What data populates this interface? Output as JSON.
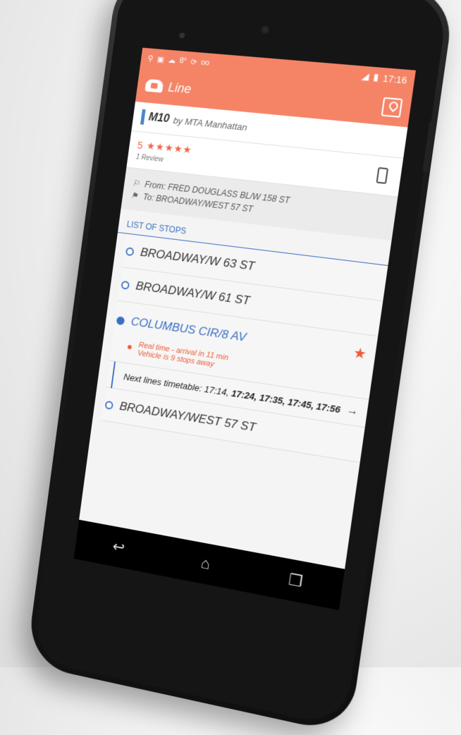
{
  "status_bar": {
    "left_icons": [
      "location-icon",
      "photo-icon",
      "cloud-icon",
      "temp-icon",
      "sync-icon",
      "voicemail-icon"
    ],
    "temp": "8°",
    "time": "17:16"
  },
  "app_bar": {
    "title": "Line",
    "map_icon": "map-icon"
  },
  "line": {
    "code": "M10",
    "by": "by MTA Manhattan",
    "accent": "#4a86c8"
  },
  "rating": {
    "score": "5",
    "stars": "★★★★★",
    "reviews": "1 Review"
  },
  "route": {
    "from": "From: FRED DOUGLASS BL/W 158 ST",
    "to": "To: BROADWAY/WEST 57 ST"
  },
  "stops": {
    "title": "LIST OF STOPS",
    "items": [
      {
        "name": "BROADWAY/W 63 ST"
      },
      {
        "name": "BROADWAY/W 61 ST"
      },
      {
        "name": "COLUMBUS CIR/8 AV",
        "active": true
      },
      {
        "name": "BROADWAY/WEST 57 ST"
      }
    ],
    "realtime_line1": "Real time - arrival in 11 min",
    "realtime_line2": "Vehicle is 9 stops away",
    "timetable_label": "Next lines timetable: ",
    "timetable_first": "17:14,",
    "timetable_rest": "17:24, 17:35, 17:45, 17:56"
  },
  "colors": {
    "brand": "#f58467",
    "accent_blue": "#3b6fc4",
    "alert": "#f05a36"
  }
}
